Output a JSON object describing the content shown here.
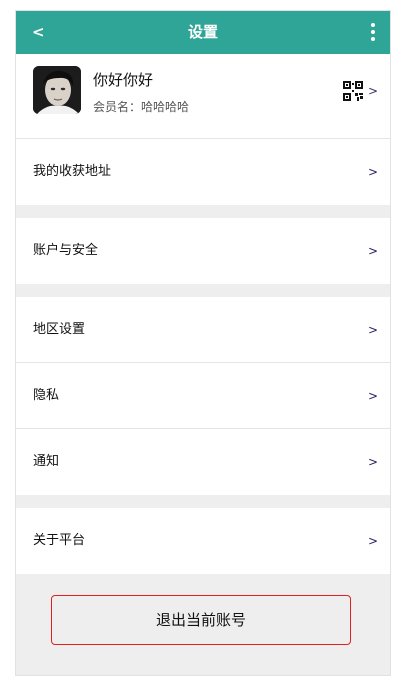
{
  "header": {
    "back_label": "<",
    "title": "设置",
    "more_icon": "more-vertical-icon"
  },
  "profile": {
    "nickname": "你好你好",
    "member_label": "会员名：",
    "member_name": "哈哈哈哈",
    "avatar_icon": "user-photo",
    "qr_icon": "qr-code-icon",
    "chevron": ">"
  },
  "rows": [
    {
      "label": "我的收获地址",
      "chevron": ">"
    },
    {
      "label": "账户与安全",
      "chevron": ">"
    },
    {
      "label": "地区设置",
      "chevron": ">"
    },
    {
      "label": "隐私",
      "chevron": ">"
    },
    {
      "label": "通知",
      "chevron": ">"
    },
    {
      "label": "关于平台",
      "chevron": ">"
    }
  ],
  "logout_label": "退出当前账号",
  "colors": {
    "header_bg": "#2ea597",
    "page_bg": "#eeeeee",
    "logout_border": "#e02020"
  }
}
